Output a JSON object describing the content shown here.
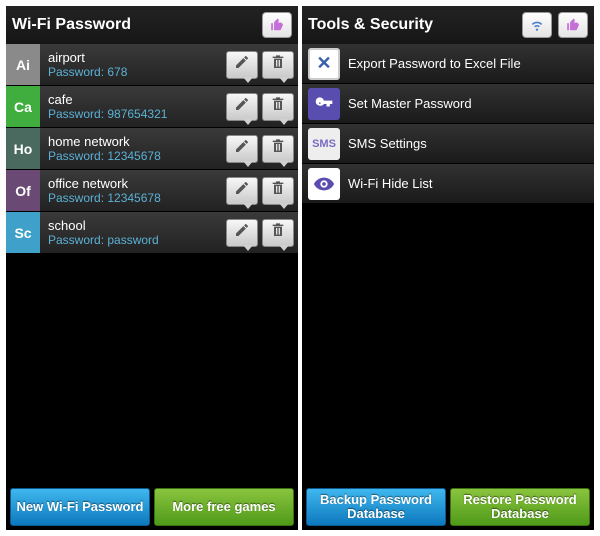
{
  "left": {
    "title": "Wi-Fi Password",
    "items": [
      {
        "badge": "Ai",
        "color": "#8a8a8a",
        "name": "airport",
        "password": "Password: 678"
      },
      {
        "badge": "Ca",
        "color": "#3fae3f",
        "name": "cafe",
        "password": "Password: 987654321"
      },
      {
        "badge": "Ho",
        "color": "#4a6a5f",
        "name": "home network",
        "password": "Password: 12345678"
      },
      {
        "badge": "Of",
        "color": "#6a4a74",
        "name": "office network",
        "password": "Password: 12345678"
      },
      {
        "badge": "Sc",
        "color": "#3fa1c9",
        "name": "school",
        "password": "Password: password"
      }
    ],
    "footer": {
      "left": "New Wi-Fi Password",
      "right": "More free games"
    }
  },
  "right": {
    "title": "Tools & Security",
    "items": [
      {
        "label": "Export Password to Excel File",
        "icon": "excel"
      },
      {
        "label": "Set Master Password",
        "icon": "key"
      },
      {
        "label": "SMS Settings",
        "icon": "sms"
      },
      {
        "label": "Wi-Fi Hide List",
        "icon": "eye"
      }
    ],
    "footer": {
      "left": "Backup Password Database",
      "right": "Restore Password Database"
    }
  }
}
